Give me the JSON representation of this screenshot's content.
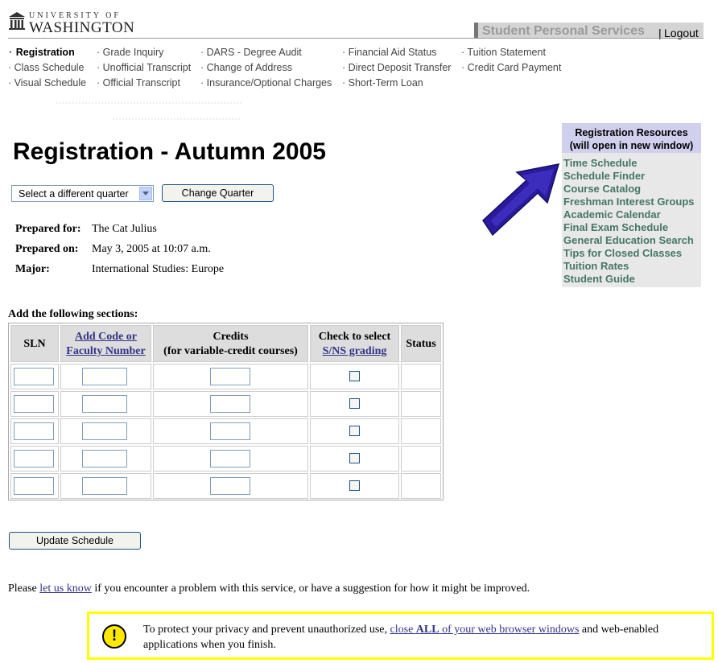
{
  "header": {
    "logo": {
      "line1": "UNIVERSITY OF",
      "line2": "WASHINGTON"
    },
    "app_title": "Student Personal Services",
    "separator": "|",
    "logout": "Logout"
  },
  "nav": {
    "col1": [
      "Registration",
      "Class Schedule",
      "Visual Schedule"
    ],
    "col2": [
      "Grade Inquiry",
      "Unofficial Transcript",
      "Official Transcript"
    ],
    "col3": [
      "DARS - Degree Audit",
      "Change of Address",
      "Insurance/Optional Charges"
    ],
    "col4": [
      "Financial Aid Status",
      "Direct Deposit Transfer",
      "Short-Term Loan"
    ],
    "col5": [
      "Tuition Statement",
      "Credit Card Payment"
    ]
  },
  "page_title": "Registration - Autumn 2005",
  "quarter_select": {
    "value": "Select a different quarter",
    "button": "Change Quarter"
  },
  "info": {
    "prepared_for_label": "Prepared for:",
    "prepared_for": "The Cat Julius",
    "prepared_on_label": "Prepared on:",
    "prepared_on": "May 3, 2005 at 10:07 a.m.",
    "major_label": "Major:",
    "major": "International Studies: Europe"
  },
  "add_heading": "Add the following sections:",
  "table": {
    "headers": {
      "sln": "SLN",
      "add_code_1": "Add Code or",
      "add_code_2": "Faculty Number",
      "credits_1": "Credits",
      "credits_2": "(for variable-credit courses)",
      "sns_1": "Check to select",
      "sns_2": "S/NS grading",
      "status": "Status"
    }
  },
  "update_button": "Update Schedule",
  "feedback": {
    "before": "Please ",
    "link": "let us know",
    "after": " if you encounter a problem with this service, or have a suggestion for how it might be improved."
  },
  "privacy": {
    "before": "To protect your privacy and prevent unauthorized use, ",
    "link_pre": "close ",
    "link_bold": "ALL",
    "link_post": " of your web browser windows",
    "after": " and web-enabled applications when you finish.",
    "icon": "!"
  },
  "resources": {
    "heading_1": "Registration Resources",
    "heading_2": "(will open in new window)",
    "links": [
      "Time Schedule",
      "Schedule Finder",
      "Course Catalog",
      "Freshman Interest Groups",
      "Academic Calendar",
      "Final Exam Schedule",
      "General Education Search",
      "Tips for Closed Classes",
      "Tuition Rates",
      "Student Guide"
    ]
  },
  "colors": {
    "link": "#333388",
    "resource_link": "#447766",
    "privacy_border": "#ffff00",
    "arrow": "#2a1a9e"
  }
}
